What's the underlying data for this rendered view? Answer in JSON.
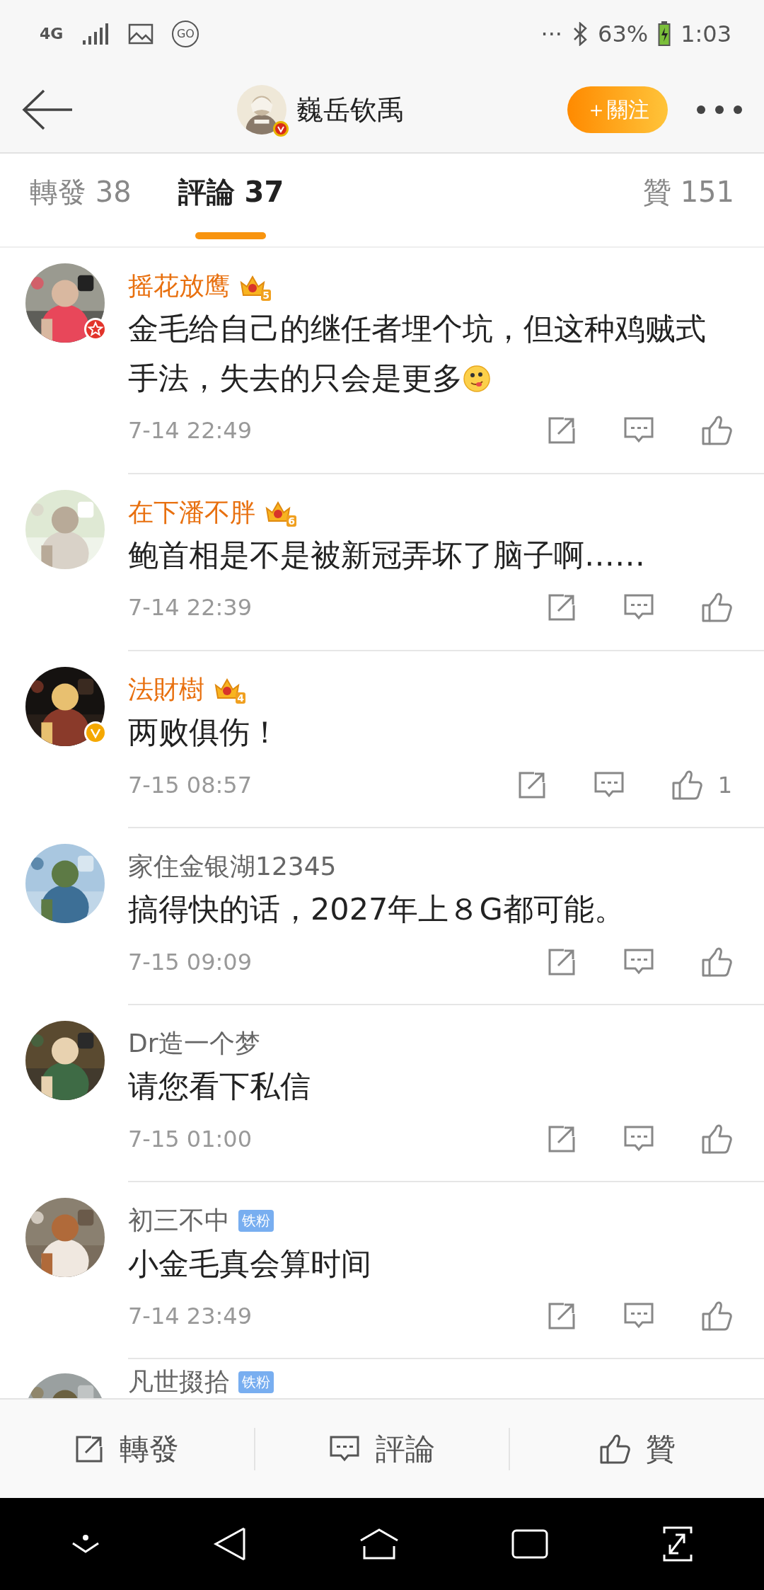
{
  "status_bar": {
    "network": "4G",
    "go_label": "GO",
    "more": "···",
    "battery": "63%",
    "time": "1:03"
  },
  "header": {
    "author": "巍岳钦禹",
    "follow_button": "＋關注"
  },
  "tabs": [
    {
      "label": "轉發 38",
      "selected": false
    },
    {
      "label": "評論 37",
      "selected": true
    },
    {
      "label": "贊 151",
      "selected": false
    }
  ],
  "comments": [
    {
      "name": "摇花放鹰",
      "vip": true,
      "avatar_badge": {
        "kind": "star"
      },
      "badge": {
        "kind": "crown",
        "text": "5"
      },
      "text": "金毛给自己的继任者埋个坑，但这种鸡贼式手法，失去的只会是更多",
      "emoji": true,
      "time": "7-14 22:49"
    },
    {
      "name": "在下潘不胖",
      "vip": true,
      "badge": {
        "kind": "crown",
        "text": "6"
      },
      "text": "鲍首相是不是被新冠弄坏了脑子啊……",
      "time": "7-14 22:39"
    },
    {
      "name": "法財樹",
      "vip": true,
      "avatar_badge": {
        "kind": "v"
      },
      "badge": {
        "kind": "crown",
        "text": "4"
      },
      "text": "两败俱伤！",
      "time": "7-15 08:57",
      "likes": "1"
    },
    {
      "name": "家住金银湖12345",
      "vip": false,
      "text": "搞得快的话，2027年上８G都可能。",
      "time": "7-15 09:09"
    },
    {
      "name": "Dr造一个梦",
      "vip": false,
      "text": "请您看下私信",
      "time": "7-15 01:00"
    },
    {
      "name": "初三不中",
      "vip": false,
      "badge": {
        "kind": "fan",
        "text": "铁粉"
      },
      "text": "小金毛真会算时间",
      "time": "7-14 23:49"
    },
    {
      "name": "凡世掇拾",
      "vip": false,
      "badge": {
        "kind": "fan",
        "text": "铁粉"
      },
      "partial": true
    }
  ],
  "bottom_bar": [
    {
      "kind": "repost",
      "label": "轉發"
    },
    {
      "kind": "comment",
      "label": "評論"
    },
    {
      "kind": "like",
      "label": "贊"
    }
  ]
}
